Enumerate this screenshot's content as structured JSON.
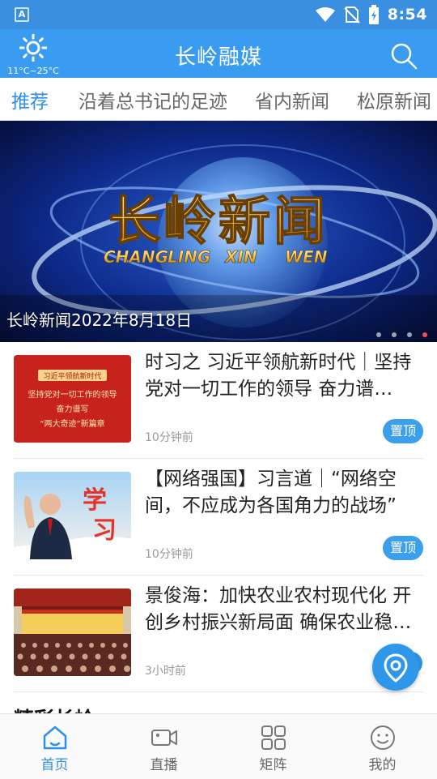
{
  "status_bar": {
    "time": "8:54",
    "left_icon": "A"
  },
  "header": {
    "title": "长岭融媒",
    "weather_temp": "11°C~25°C"
  },
  "tabs": [
    {
      "label": "推荐",
      "active": true
    },
    {
      "label": "沿着总书记的足迹",
      "active": false
    },
    {
      "label": "省内新闻",
      "active": false
    },
    {
      "label": "松原新闻",
      "active": false
    }
  ],
  "banner": {
    "logo_cn": "长岭新闻",
    "logo_en": [
      "CHANG",
      "LING",
      "XIN",
      "WEN"
    ],
    "caption": "长岭新闻2022年8月18日",
    "slide_count": 4,
    "active_slide": 4
  },
  "news": [
    {
      "title": "时习之 习近平领航新时代｜坚持党对一切工作的领导 奋力谱…",
      "time": "10分钟前",
      "badge": "置顶",
      "thumb_lines": [
        "习近平领航新时代",
        "坚持党对一切工作的领导",
        "奋力谱写",
        "“两大奇迹”新篇章"
      ]
    },
    {
      "title": "【网络强国】习言道｜“网络空间，不应成为各国角力的战场”",
      "time": "10分钟前",
      "badge": "置顶",
      "thumb_lines": [
        "学",
        "习"
      ]
    },
    {
      "title": "景俊海：加快农业农村现代化 开创乡村振兴新局面 确保农业稳…",
      "time": "3小时前",
      "badge": "",
      "thumb_lines": []
    }
  ],
  "section": {
    "title": "精彩长岭"
  },
  "bottom_nav": [
    {
      "label": "首页",
      "icon": "home-icon",
      "active": true
    },
    {
      "label": "直播",
      "icon": "video-camera-icon",
      "active": false
    },
    {
      "label": "矩阵",
      "icon": "grid-icon",
      "active": false
    },
    {
      "label": "我的",
      "icon": "smiley-icon",
      "active": false
    }
  ],
  "colors": {
    "primary": "#3a9cf0",
    "accent_red": "#ff4a58",
    "active_blue": "#2f8ee6"
  }
}
